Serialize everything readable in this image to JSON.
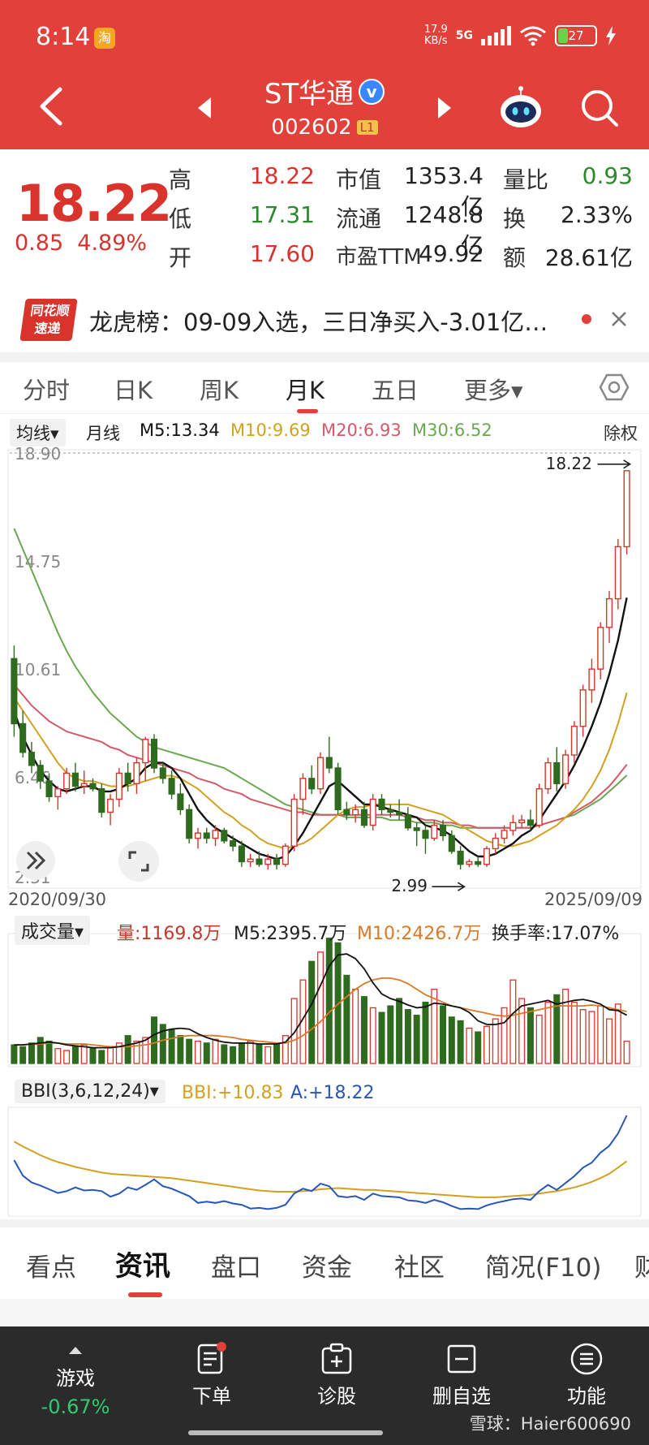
{
  "status_bar": {
    "time": "8:14",
    "app_badge": "淘",
    "net_speed_value": "17.9",
    "net_speed_unit": "KB/s",
    "network": "5G",
    "battery": "27"
  },
  "header": {
    "stock_name": "ST华通",
    "verified_mark": "v",
    "stock_code": "002602",
    "level_badge": "L1"
  },
  "quote": {
    "price": "18.22",
    "change": "0.85",
    "change_pct": "4.89%",
    "high_label": "高",
    "high": "18.22",
    "low_label": "低",
    "low": "17.31",
    "open_label": "开",
    "open": "17.60",
    "mcap_label": "市值",
    "mcap": "1353.4亿",
    "float_label": "流通",
    "float": "1248.8亿",
    "pe_label": "市盈TTM",
    "pe": "49.92",
    "vr_label": "量比",
    "vr": "0.93",
    "turnover_label": "换",
    "turnover": "2.33%",
    "amount_label": "额",
    "amount": "28.61亿"
  },
  "dragon": {
    "logo_line1": "同花顺",
    "logo_line2": "速递",
    "text": "龙虎榜：09-09入选，三日净买入-3.01亿…"
  },
  "period_tabs": [
    "分时",
    "日K",
    "周K",
    "月K",
    "五日",
    "更多▾"
  ],
  "ma_bar": {
    "selector": "均线▾",
    "period": "月线",
    "m5": "M5:13.34",
    "m10": "M10:9.69",
    "m20": "M20:6.93",
    "m30": "M30:6.52",
    "adjust": "除权"
  },
  "dates": {
    "start": "2020/09/30",
    "end": "2025/09/09"
  },
  "volume_bar": {
    "selector": "成交量▾",
    "vol": "量:1169.8万",
    "m5": "M5:2395.7万",
    "m10": "M10:2426.7万",
    "turnover": "换手率:17.07%"
  },
  "bbi_bar": {
    "selector": "BBI(3,6,12,24)▾",
    "bbi": "BBI:+10.83",
    "a": "A:+18.22"
  },
  "info_tabs": [
    "看点",
    "资讯",
    "盘口",
    "资金",
    "社区",
    "简况(F10)",
    "财"
  ],
  "bottom_bar": {
    "game": "游戏",
    "game_pct": "-0.67%",
    "order": "下单",
    "diagnose": "诊股",
    "remove": "删自选",
    "function": "功能"
  },
  "watermark": "雪球：Haier600690",
  "colors": {
    "header_red": "#e2403a",
    "up_red": "#d8342c",
    "down_green": "#2f6b1f",
    "m5": "#111111",
    "m10": "#d4a020",
    "m20": "#d45a6a",
    "m30": "#6aa84f",
    "bbi_line": "#d4a020",
    "a_line": "#2856b8"
  },
  "chart_data": {
    "type": "candlestick",
    "title": "",
    "ylim": [
      2.31,
      18.9
    ],
    "y_ticks": [
      18.9,
      14.75,
      10.61,
      6.46,
      2.31
    ],
    "y_tick_labels": [
      "18.90",
      "14.75",
      "10.61",
      "6.46",
      "2.31"
    ],
    "x_start": "2020/09/30",
    "x_end": "2025/09/09",
    "last_price_label": "18.22",
    "low_label": "2.99",
    "candles": [
      [
        11.0,
        11.5,
        8.0,
        8.5
      ],
      [
        8.5,
        9.0,
        7.2,
        7.4
      ],
      [
        7.4,
        7.8,
        6.6,
        6.9
      ],
      [
        6.9,
        7.1,
        6.0,
        6.3
      ],
      [
        6.3,
        6.6,
        5.5,
        5.7
      ],
      [
        5.7,
        6.1,
        5.2,
        6.0
      ],
      [
        6.0,
        6.8,
        5.8,
        6.6
      ],
      [
        6.6,
        7.0,
        5.9,
        6.1
      ],
      [
        6.1,
        6.7,
        5.8,
        6.2
      ],
      [
        6.2,
        6.4,
        5.9,
        6.0
      ],
      [
        6.0,
        6.2,
        4.9,
        5.1
      ],
      [
        5.1,
        5.8,
        4.6,
        5.6
      ],
      [
        5.6,
        6.8,
        5.3,
        6.6
      ],
      [
        6.6,
        7.0,
        5.9,
        6.2
      ],
      [
        6.2,
        7.2,
        5.8,
        7.0
      ],
      [
        7.0,
        8.0,
        6.3,
        7.9
      ],
      [
        7.9,
        8.1,
        6.6,
        6.8
      ],
      [
        6.8,
        7.0,
        6.2,
        6.4
      ],
      [
        6.4,
        6.7,
        5.6,
        5.8
      ],
      [
        5.8,
        6.2,
        5.0,
        5.2
      ],
      [
        5.2,
        5.4,
        3.9,
        4.1
      ],
      [
        4.1,
        4.5,
        3.7,
        4.3
      ],
      [
        4.3,
        4.5,
        3.9,
        4.1
      ],
      [
        4.1,
        4.6,
        3.8,
        4.4
      ],
      [
        4.4,
        4.5,
        3.9,
        4.0
      ],
      [
        4.0,
        4.2,
        3.6,
        3.8
      ],
      [
        3.8,
        4.0,
        3.0,
        3.2
      ],
      [
        3.2,
        3.5,
        3.0,
        3.3
      ],
      [
        3.3,
        3.6,
        3.0,
        3.1
      ],
      [
        3.1,
        3.5,
        2.9,
        3.3
      ],
      [
        3.3,
        3.5,
        2.9,
        3.1
      ],
      [
        3.1,
        3.9,
        3.0,
        3.8
      ],
      [
        3.8,
        5.8,
        3.6,
        5.6
      ],
      [
        5.6,
        6.6,
        5.0,
        6.4
      ],
      [
        6.4,
        6.9,
        5.8,
        6.0
      ],
      [
        6.0,
        7.4,
        5.8,
        7.2
      ],
      [
        7.2,
        8.0,
        6.6,
        6.8
      ],
      [
        6.8,
        7.0,
        5.0,
        5.2
      ],
      [
        5.2,
        5.5,
        4.8,
        5.0
      ],
      [
        5.0,
        5.4,
        4.7,
        5.2
      ],
      [
        5.2,
        5.5,
        4.5,
        4.6
      ],
      [
        4.6,
        5.8,
        4.4,
        5.6
      ],
      [
        5.6,
        5.8,
        5.0,
        5.2
      ],
      [
        5.2,
        5.4,
        4.9,
        5.1
      ],
      [
        5.1,
        5.6,
        4.8,
        5.0
      ],
      [
        5.0,
        5.3,
        4.4,
        4.5
      ],
      [
        4.5,
        4.7,
        3.8,
        4.4
      ],
      [
        4.4,
        4.6,
        3.5,
        4.1
      ],
      [
        4.1,
        4.8,
        4.0,
        4.6
      ],
      [
        4.6,
        4.8,
        4.0,
        4.2
      ],
      [
        4.2,
        4.4,
        3.5,
        3.6
      ],
      [
        3.6,
        3.8,
        2.9,
        3.1
      ],
      [
        3.1,
        3.3,
        2.99,
        3.2
      ],
      [
        3.2,
        3.4,
        3.0,
        3.1
      ],
      [
        3.1,
        3.8,
        3.0,
        3.7
      ],
      [
        3.7,
        4.3,
        3.5,
        4.1
      ],
      [
        4.1,
        4.6,
        3.9,
        4.4
      ],
      [
        4.4,
        5.0,
        4.2,
        4.7
      ],
      [
        4.7,
        5.0,
        4.5,
        4.8
      ],
      [
        4.8,
        5.2,
        4.4,
        4.6
      ],
      [
        4.6,
        6.2,
        4.5,
        6.0
      ],
      [
        6.0,
        7.2,
        5.8,
        7.0
      ],
      [
        7.0,
        7.6,
        5.9,
        6.2
      ],
      [
        6.2,
        7.5,
        6.0,
        7.3
      ],
      [
        7.3,
        8.6,
        7.0,
        8.4
      ],
      [
        8.4,
        10.0,
        8.0,
        9.8
      ],
      [
        9.8,
        11.0,
        9.3,
        10.6
      ],
      [
        10.6,
        12.4,
        10.2,
        12.2
      ],
      [
        12.2,
        13.6,
        11.6,
        13.3
      ],
      [
        13.3,
        15.6,
        12.9,
        15.3
      ],
      [
        15.3,
        18.22,
        15.0,
        18.22
      ]
    ],
    "series": [
      {
        "name": "M5",
        "values": [
          9.0,
          8.0,
          7.3,
          6.7,
          6.3,
          6.0,
          5.9,
          6.0,
          6.1,
          6.1,
          5.9,
          5.9,
          6.0,
          6.2,
          6.4,
          6.8,
          7.0,
          7.0,
          6.8,
          6.4,
          5.8,
          5.2,
          4.8,
          4.5,
          4.3,
          4.1,
          3.9,
          3.7,
          3.5,
          3.4,
          3.3,
          3.4,
          3.8,
          4.3,
          4.9,
          5.5,
          6.1,
          6.3,
          6.0,
          5.7,
          5.4,
          5.4,
          5.3,
          5.2,
          5.1,
          5.0,
          4.9,
          4.6,
          4.5,
          4.4,
          4.2,
          3.9,
          3.6,
          3.4,
          3.4,
          3.5,
          3.7,
          3.9,
          4.2,
          4.4,
          4.8,
          5.3,
          5.8,
          6.3,
          6.9,
          7.6,
          8.4,
          9.3,
          10.4,
          11.7,
          13.34
        ]
      },
      {
        "name": "M10",
        "values": [
          9.5,
          9.0,
          8.5,
          8.0,
          7.5,
          7.0,
          6.6,
          6.4,
          6.3,
          6.3,
          6.2,
          6.1,
          6.1,
          6.1,
          6.2,
          6.3,
          6.4,
          6.5,
          6.5,
          6.4,
          6.2,
          6.0,
          5.7,
          5.4,
          5.1,
          4.9,
          4.6,
          4.4,
          4.1,
          3.9,
          3.8,
          3.7,
          3.8,
          3.9,
          4.1,
          4.4,
          4.7,
          5.0,
          5.2,
          5.3,
          5.3,
          5.4,
          5.4,
          5.4,
          5.4,
          5.4,
          5.3,
          5.2,
          5.1,
          5.0,
          4.8,
          4.6,
          4.4,
          4.2,
          4.0,
          3.9,
          3.8,
          3.8,
          3.9,
          4.0,
          4.2,
          4.4,
          4.6,
          4.9,
          5.2,
          5.6,
          6.1,
          6.7,
          7.5,
          8.5,
          9.69
        ]
      },
      {
        "name": "M20",
        "values": [
          10.0,
          9.6,
          9.2,
          8.9,
          8.6,
          8.4,
          8.2,
          8.1,
          8.0,
          7.9,
          7.8,
          7.6,
          7.5,
          7.3,
          7.2,
          7.1,
          7.0,
          6.9,
          6.8,
          6.7,
          6.6,
          6.4,
          6.3,
          6.2,
          6.0,
          5.9,
          5.8,
          5.6,
          5.5,
          5.4,
          5.3,
          5.2,
          5.1,
          5.1,
          5.0,
          5.0,
          5.0,
          5.0,
          5.0,
          5.0,
          5.0,
          5.0,
          5.0,
          5.0,
          5.0,
          4.9,
          4.9,
          4.8,
          4.8,
          4.7,
          4.7,
          4.6,
          4.6,
          4.5,
          4.5,
          4.5,
          4.5,
          4.5,
          4.5,
          4.5,
          4.6,
          4.7,
          4.8,
          4.9,
          5.1,
          5.3,
          5.5,
          5.8,
          6.1,
          6.5,
          6.93
        ]
      },
      {
        "name": "M30",
        "values": [
          16.0,
          15.2,
          14.4,
          13.6,
          12.8,
          12.0,
          11.3,
          10.7,
          10.2,
          9.7,
          9.3,
          8.9,
          8.6,
          8.3,
          8.0,
          7.8,
          7.6,
          7.5,
          7.4,
          7.3,
          7.2,
          7.1,
          7.0,
          6.9,
          6.8,
          6.6,
          6.4,
          6.2,
          6.0,
          5.8,
          5.6,
          5.4,
          5.3,
          5.2,
          5.1,
          5.0,
          5.0,
          5.0,
          4.9,
          4.9,
          4.9,
          4.9,
          4.9,
          4.8,
          4.8,
          4.8,
          4.7,
          4.7,
          4.7,
          4.6,
          4.6,
          4.5,
          4.5,
          4.5,
          4.5,
          4.5,
          4.5,
          4.5,
          4.5,
          4.5,
          4.6,
          4.7,
          4.8,
          4.9,
          5.0,
          5.2,
          5.4,
          5.6,
          5.9,
          6.2,
          6.52
        ]
      }
    ],
    "volume": [
      20,
      18,
      22,
      28,
      24,
      16,
      14,
      18,
      20,
      16,
      14,
      18,
      22,
      30,
      24,
      28,
      50,
      42,
      36,
      30,
      26,
      24,
      22,
      26,
      20,
      18,
      22,
      24,
      20,
      18,
      22,
      30,
      70,
      90,
      110,
      120,
      135,
      130,
      95,
      80,
      72,
      60,
      55,
      62,
      70,
      58,
      52,
      66,
      80,
      62,
      50,
      46,
      38,
      34,
      40,
      48,
      60,
      90,
      70,
      60,
      52,
      66,
      74,
      80,
      66,
      58,
      56,
      62,
      48,
      64,
      24
    ],
    "volume_ma5": [
      20,
      20,
      21,
      22,
      23,
      22,
      20,
      19,
      18,
      17,
      17,
      17,
      18,
      20,
      22,
      25,
      31,
      35,
      37,
      38,
      37,
      32,
      28,
      25,
      23,
      22,
      22,
      22,
      21,
      21,
      21,
      23,
      33,
      48,
      64,
      84,
      105,
      117,
      118,
      113,
      102,
      87,
      75,
      70,
      67,
      63,
      60,
      61,
      65,
      64,
      62,
      60,
      55,
      46,
      42,
      42,
      44,
      54,
      62,
      64,
      66,
      68,
      64,
      66,
      68,
      69,
      67,
      64,
      58,
      57,
      52
    ],
    "volume_ma10": [
      20,
      20,
      21,
      21,
      22,
      22,
      21,
      21,
      21,
      20,
      19,
      18,
      18,
      18,
      19,
      20,
      22,
      25,
      27,
      29,
      30,
      30,
      30,
      30,
      29,
      28,
      26,
      25,
      24,
      23,
      22,
      22,
      25,
      30,
      37,
      45,
      55,
      64,
      72,
      80,
      86,
      90,
      92,
      92,
      90,
      86,
      80,
      74,
      70,
      66,
      62,
      60,
      58,
      56,
      54,
      52,
      51,
      52,
      54,
      56,
      58,
      60,
      62,
      62,
      62,
      62,
      63,
      62,
      60,
      58,
      56
    ],
    "bbi": [
      14.0,
      13.2,
      12.5,
      11.8,
      11.2,
      10.7,
      10.3,
      9.9,
      9.6,
      9.3,
      9.0,
      8.8,
      8.7,
      8.6,
      8.5,
      8.4,
      8.3,
      8.2,
      8.1,
      7.9,
      7.7,
      7.5,
      7.3,
      7.1,
      6.9,
      6.7,
      6.5,
      6.3,
      6.1,
      6.0,
      5.9,
      5.9,
      5.9,
      6.0,
      6.1,
      6.3,
      6.4,
      6.5,
      6.4,
      6.3,
      6.2,
      6.2,
      6.1,
      6.0,
      5.9,
      5.8,
      5.7,
      5.6,
      5.5,
      5.4,
      5.3,
      5.2,
      5.1,
      5.0,
      5.0,
      5.0,
      5.1,
      5.2,
      5.3,
      5.4,
      5.6,
      5.8,
      6.0,
      6.3,
      6.6,
      7.0,
      7.5,
      8.1,
      8.8,
      9.8,
      10.83
    ],
    "bbi_a": [
      11.0,
      8.5,
      7.4,
      6.9,
      6.3,
      5.7,
      6.0,
      6.6,
      6.1,
      6.2,
      6.0,
      5.1,
      5.6,
      6.6,
      6.2,
      7.0,
      7.9,
      6.8,
      6.4,
      5.8,
      5.2,
      4.1,
      4.3,
      4.1,
      4.4,
      4.0,
      3.8,
      3.2,
      3.3,
      3.1,
      3.3,
      3.8,
      5.6,
      6.4,
      6.0,
      7.2,
      6.8,
      5.2,
      5.0,
      5.2,
      4.6,
      5.6,
      5.2,
      5.1,
      5.0,
      4.5,
      4.4,
      4.1,
      4.6,
      4.2,
      3.6,
      3.1,
      3.2,
      3.1,
      3.7,
      4.1,
      4.4,
      4.7,
      4.8,
      4.6,
      6.0,
      7.0,
      6.2,
      7.3,
      8.4,
      9.8,
      10.6,
      12.2,
      13.3,
      15.3,
      18.22
    ]
  }
}
